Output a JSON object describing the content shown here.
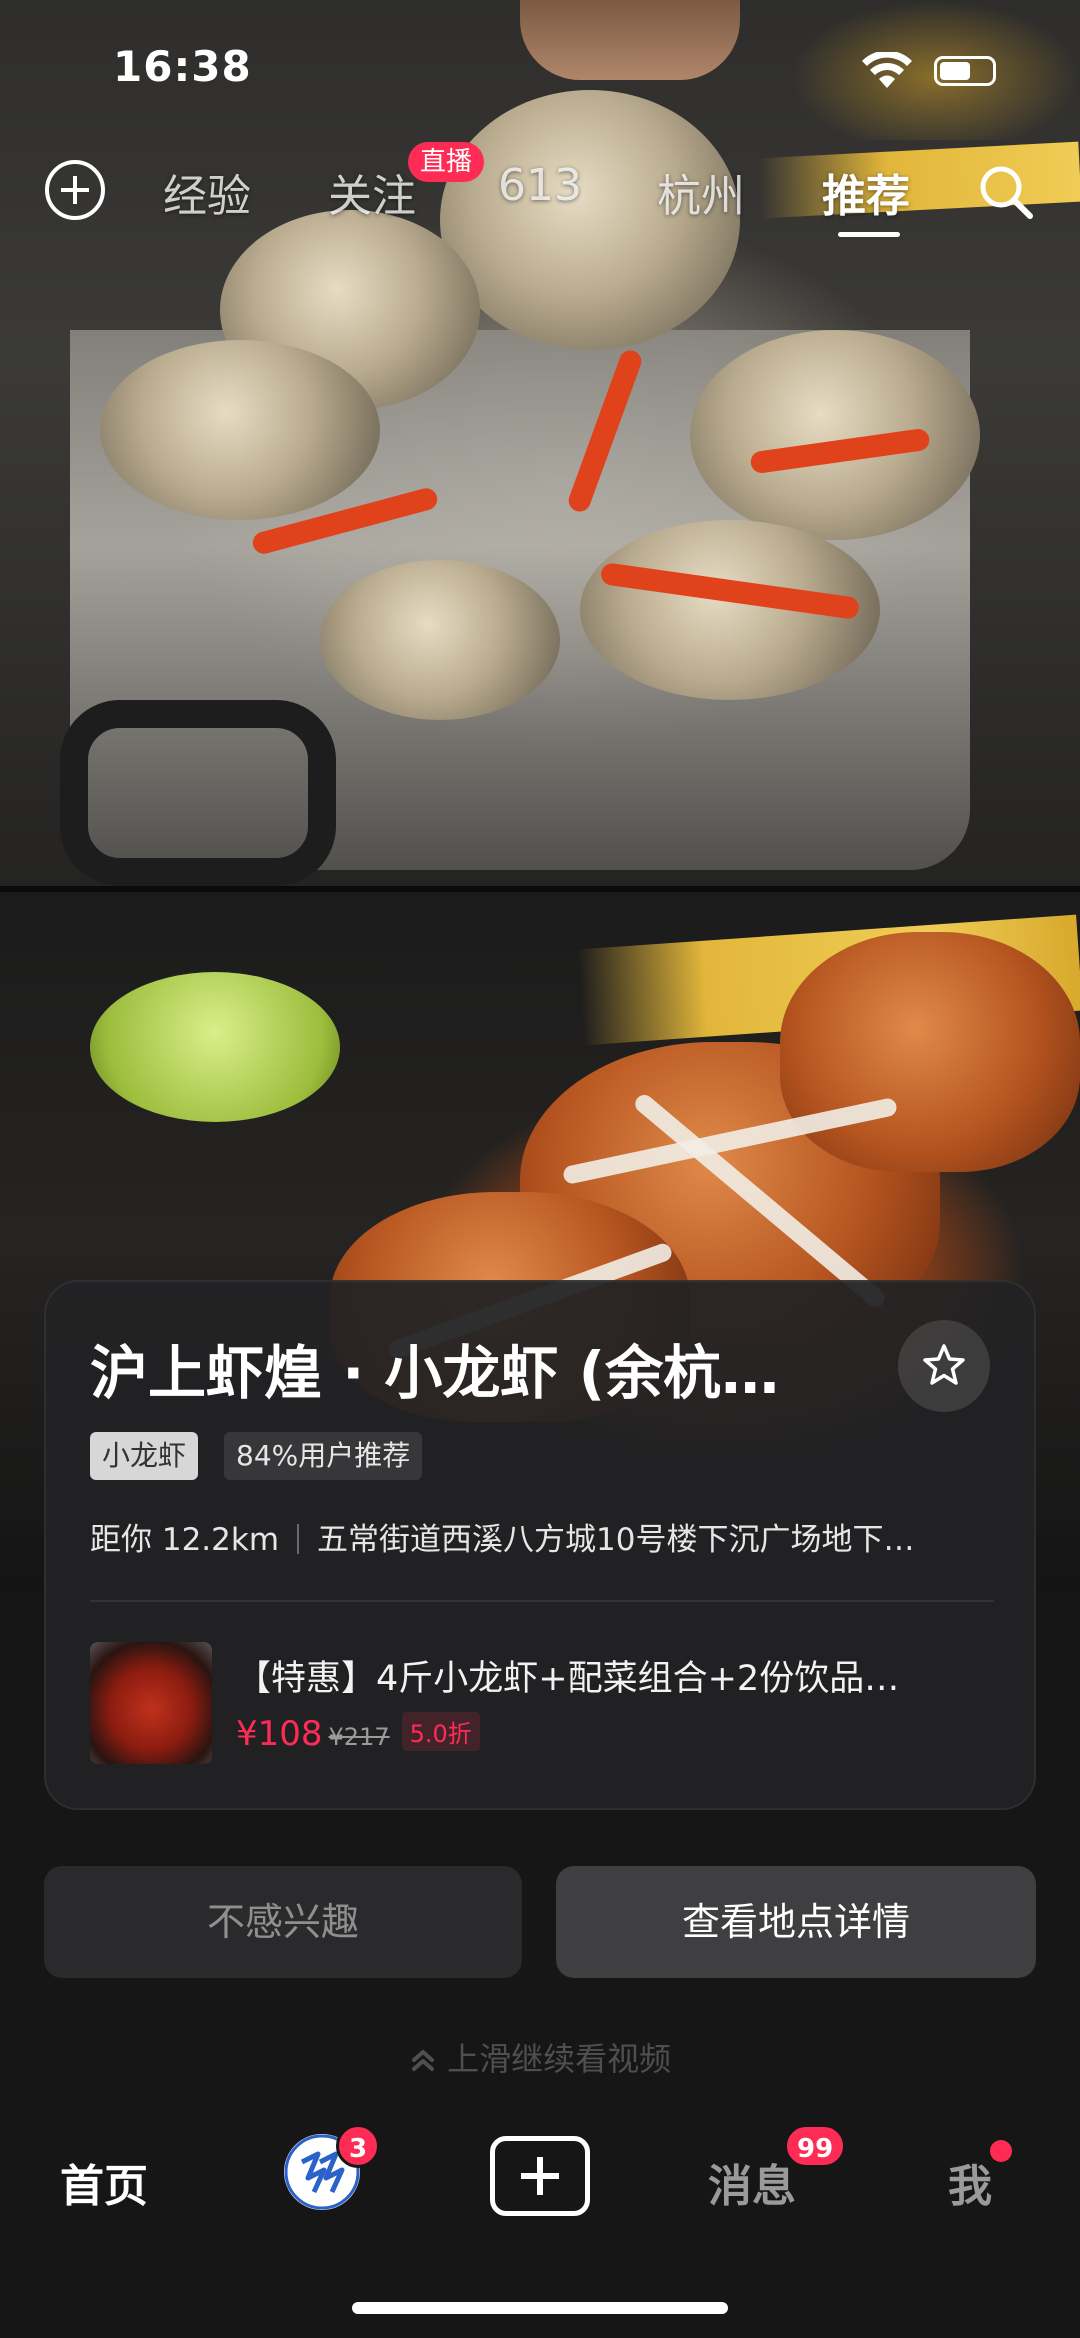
{
  "status_bar": {
    "time": "16:38"
  },
  "top_nav": {
    "tabs": [
      {
        "label": "经验"
      },
      {
        "label": "关注",
        "badge": "直播"
      },
      {
        "label": "613"
      },
      {
        "label": "杭州"
      },
      {
        "label": "推荐",
        "active": true
      }
    ]
  },
  "poi_card": {
    "title": "沪上虾煌 · 小龙虾 (余杭…",
    "category_tag": "小龙虾",
    "recommend_tag": "84%用户推荐",
    "distance": "距你 12.2km",
    "address": "五常街道西溪八方城10号楼下沉广场地下…",
    "deal": {
      "title": "【特惠】4斤小龙虾+配菜组合+2份饮品…",
      "price": "¥108",
      "original_price": "¥217",
      "discount": "5.0折"
    }
  },
  "actions": {
    "not_interested": "不感兴趣",
    "view_details": "查看地点详情"
  },
  "swipe_hint": "上滑继续看视频",
  "bottom_nav": {
    "home": "首页",
    "friends_badge": "3",
    "messages": "消息",
    "messages_badge": "99",
    "me": "我"
  },
  "colors": {
    "accent": "#fe2c55",
    "background": "#161616",
    "card": "#222224"
  },
  "icons": [
    "add-circle-icon",
    "search-icon",
    "star-icon",
    "chevron-up-double-icon",
    "plus-icon"
  ]
}
